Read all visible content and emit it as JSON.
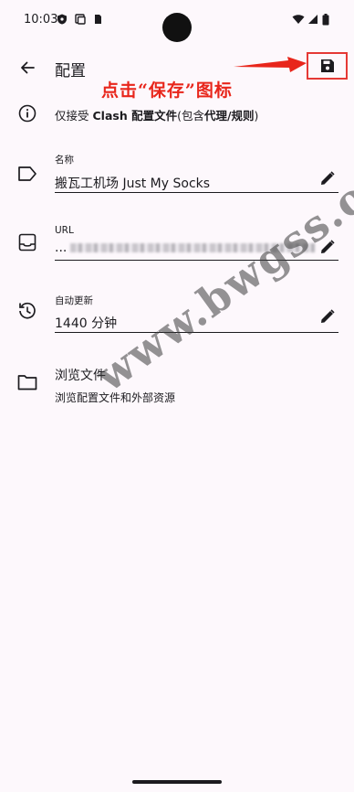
{
  "status_bar": {
    "time": "10:03"
  },
  "app_bar": {
    "title": "配置"
  },
  "annotation": {
    "text": "点击“保存”图标",
    "color": "#e8261b"
  },
  "info": {
    "prefix": "仅接受 ",
    "bold1": "Clash 配置文件",
    "mid": "(包含",
    "bold2": "代理/规则",
    "suffix": ")"
  },
  "fields": {
    "name": {
      "label": "名称",
      "value": "搬瓦工机场 Just My Socks"
    },
    "url": {
      "label": "URL",
      "value_prefix": "..."
    },
    "auto_update": {
      "label": "自动更新",
      "value": "1440 分钟"
    }
  },
  "browse": {
    "title": "浏览文件",
    "subtitle": "浏览配置文件和外部资源"
  },
  "watermark": {
    "text": "www.bwgss.org"
  }
}
